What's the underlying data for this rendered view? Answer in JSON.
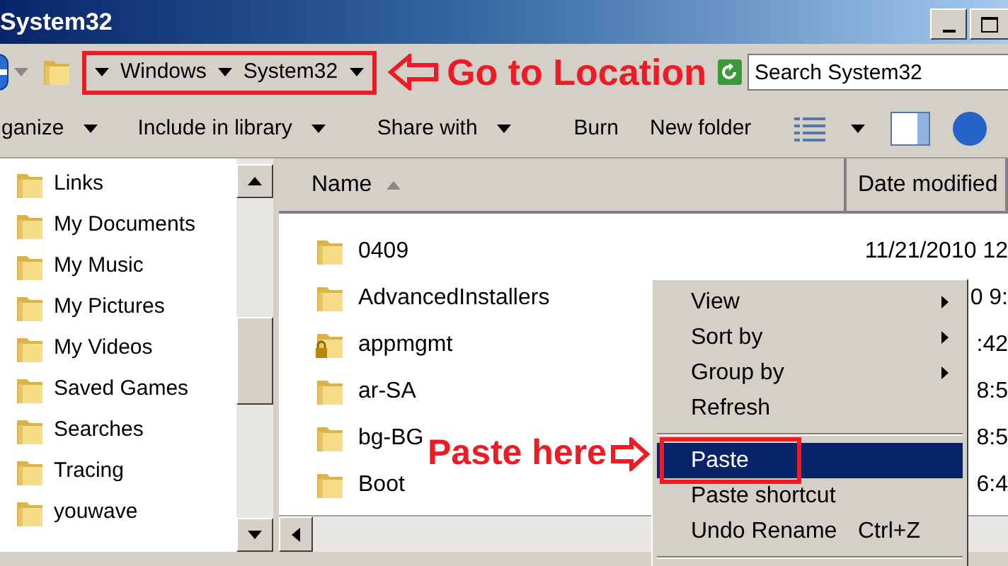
{
  "window": {
    "title": "System32"
  },
  "address_bar": {
    "breadcrumbs": [
      "Windows",
      "System32"
    ],
    "annotated": true
  },
  "search": {
    "placeholder": "Search System32"
  },
  "toolbar": {
    "items": [
      {
        "label": "ganize",
        "dropdown": true
      },
      {
        "label": "Include in library",
        "dropdown": true
      },
      {
        "label": "Share with",
        "dropdown": true
      },
      {
        "label": "Burn",
        "dropdown": false
      },
      {
        "label": "New folder",
        "dropdown": false
      }
    ]
  },
  "navigation_pane": {
    "items": [
      {
        "label": "Links"
      },
      {
        "label": "My Documents"
      },
      {
        "label": "My Music"
      },
      {
        "label": "My Pictures"
      },
      {
        "label": "My Videos"
      },
      {
        "label": "Saved Games"
      },
      {
        "label": "Searches"
      },
      {
        "label": "Tracing"
      },
      {
        "label": "youwave"
      }
    ]
  },
  "file_list": {
    "columns": [
      {
        "label": "Name",
        "sorted": true
      },
      {
        "label": "Date modified",
        "sorted": false
      }
    ],
    "rows": [
      {
        "name": "0409",
        "date_modified": "11/21/2010 12",
        "locked": false
      },
      {
        "name": "AdvancedInstallers",
        "date_modified": "0 9:",
        "locked": false
      },
      {
        "name": "appmgmt",
        "date_modified": ":42",
        "locked": true
      },
      {
        "name": "ar-SA",
        "date_modified": "8:5",
        "locked": false
      },
      {
        "name": "bg-BG",
        "date_modified": "8:5",
        "locked": false
      },
      {
        "name": "Boot",
        "date_modified": "6:4",
        "locked": false
      }
    ]
  },
  "context_menu": {
    "items": [
      {
        "kind": "item",
        "label": "View",
        "submenu": true,
        "selected": false,
        "annotated": false
      },
      {
        "kind": "item",
        "label": "Sort by",
        "submenu": true,
        "selected": false,
        "annotated": false
      },
      {
        "kind": "item",
        "label": "Group by",
        "submenu": true,
        "selected": false,
        "annotated": false
      },
      {
        "kind": "item",
        "label": "Refresh",
        "submenu": false,
        "selected": false,
        "annotated": false
      },
      {
        "kind": "separator"
      },
      {
        "kind": "item",
        "label": "Paste",
        "submenu": false,
        "selected": true,
        "annotated": true
      },
      {
        "kind": "item",
        "label": "Paste shortcut",
        "submenu": false,
        "selected": false,
        "annotated": false
      },
      {
        "kind": "item",
        "label": "Undo Rename",
        "shortcut": "Ctrl+Z",
        "submenu": false,
        "selected": false,
        "annotated": false
      },
      {
        "kind": "separator"
      }
    ]
  },
  "annotations": [
    {
      "kind": "location_callout",
      "text": "Go to Location"
    },
    {
      "kind": "paste_callout",
      "text": "Paste here"
    }
  ]
}
